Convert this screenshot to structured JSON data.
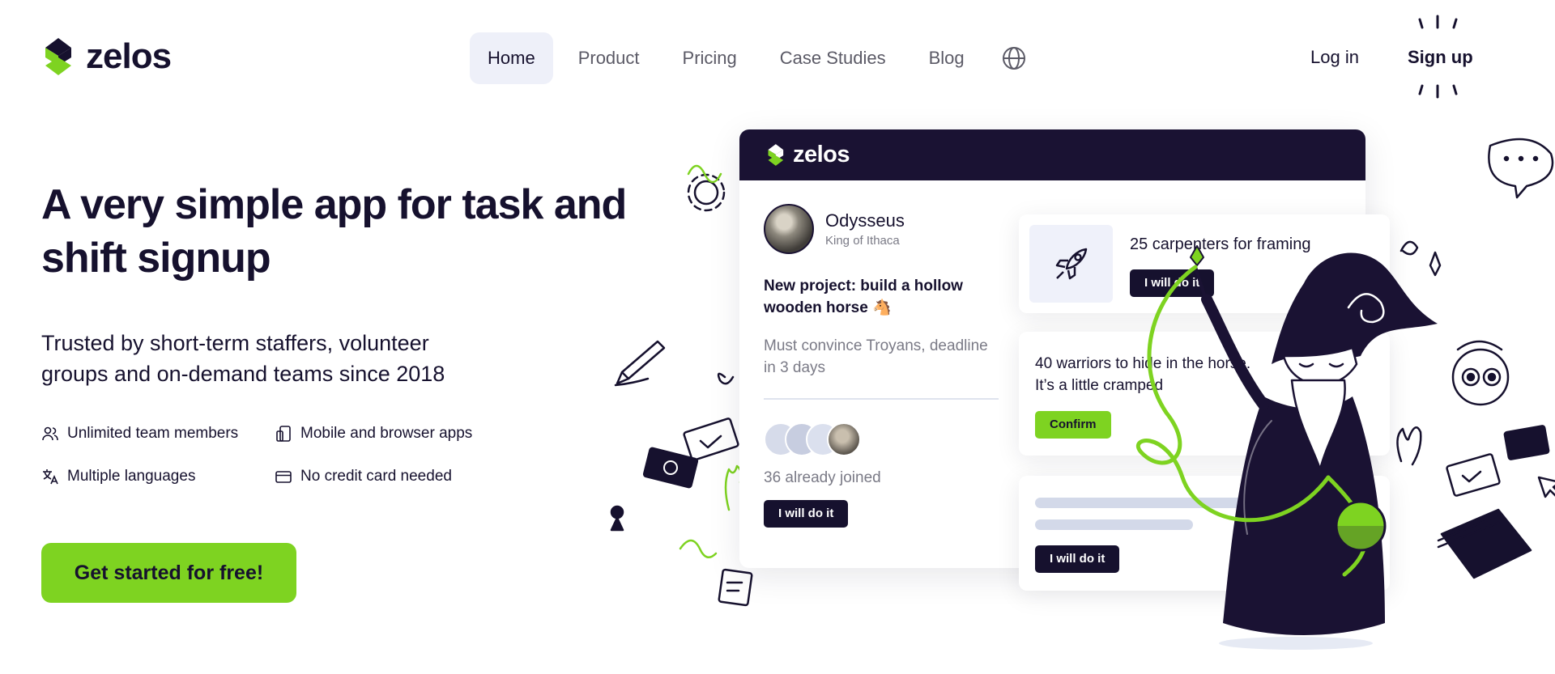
{
  "brand": {
    "name": "zelos",
    "accent": "#7ed321",
    "dark": "#16112e"
  },
  "nav": {
    "items": [
      {
        "label": "Home",
        "active": true
      },
      {
        "label": "Product",
        "active": false
      },
      {
        "label": "Pricing",
        "active": false
      },
      {
        "label": "Case Studies",
        "active": false
      },
      {
        "label": "Blog",
        "active": false
      }
    ],
    "language_icon": "globe-icon",
    "login_label": "Log in",
    "signup_label": "Sign up"
  },
  "hero": {
    "title": "A very simple app for task and shift signup",
    "subtitle": "Trusted by short-term staffers, volunteer groups and on-demand teams since 2018",
    "features": [
      {
        "icon": "users-icon",
        "label": "Unlimited team members"
      },
      {
        "icon": "devices-icon",
        "label": "Mobile and browser apps"
      },
      {
        "icon": "translate-icon",
        "label": "Multiple languages"
      },
      {
        "icon": "credit-card-icon",
        "label": "No credit card needed"
      }
    ],
    "cta_label": "Get started for free!"
  },
  "mockup": {
    "app_name": "zelos",
    "post": {
      "author_name": "Odysseus",
      "author_role": "King of Ithaca",
      "title": "New project: build a hollow wooden horse 🐴",
      "description": "Must convince Troyans, deadline in 3 days",
      "joined_text": "36 already joined",
      "button_label": "I will do it"
    },
    "tasks": [
      {
        "icon": "rocket-icon",
        "title": "25 carpenters for framing",
        "button_label": "I will do it"
      },
      {
        "title": "40 warriors to hide in the horse. It’s a little cramped",
        "button_label": "Confirm"
      },
      {
        "button_label": "I will do it"
      }
    ]
  }
}
